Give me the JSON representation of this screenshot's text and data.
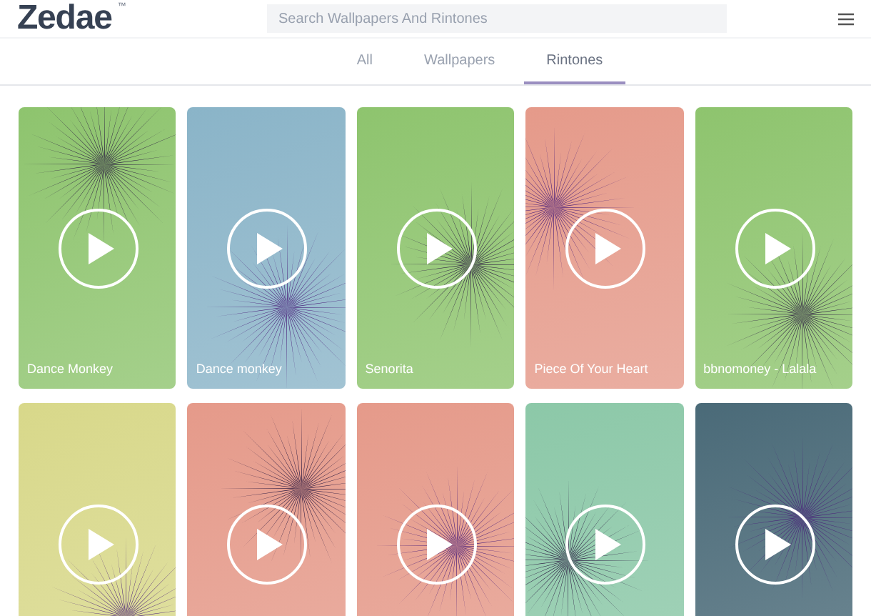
{
  "header": {
    "logo": "Zedae",
    "logo_mark": "™",
    "search": {
      "placeholder": "Search Wallpapers And Rintones"
    }
  },
  "tabs": [
    {
      "label": "All",
      "selected": false
    },
    {
      "label": "Wallpapers",
      "selected": false
    },
    {
      "label": "Rintones",
      "selected": true
    }
  ],
  "cards": [
    {
      "title": "Dance Monkey",
      "color": "#8ec46e"
    },
    {
      "title": "Dance monkey",
      "color": "#8ab4c8"
    },
    {
      "title": "Senorita",
      "color": "#8ec46e"
    },
    {
      "title": "Piece Of Your Heart",
      "color": "#e59a8a"
    },
    {
      "title": "bbnomoney - Lalala",
      "color": "#8ec46e"
    },
    {
      "color": "#d8d88a"
    },
    {
      "color": "#e59a8a"
    },
    {
      "color": "#e59a8a"
    },
    {
      "color": "#8cc8a8"
    },
    {
      "color": "#4a6a78"
    }
  ]
}
